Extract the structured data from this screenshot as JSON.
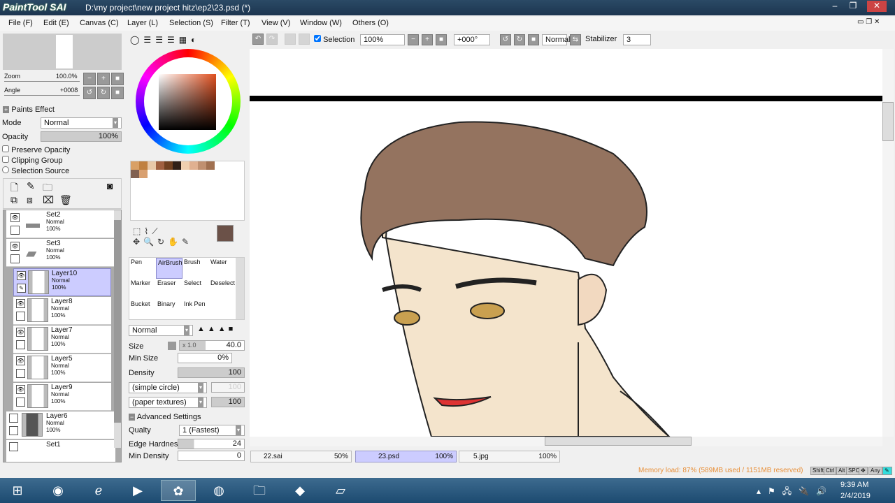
{
  "window": {
    "app_logo": "PaintTool SAI",
    "title": "D:\\my project\\new project hitz\\ep2\\23.psd (*)"
  },
  "menu": [
    "File (F)",
    "Edit (E)",
    "Canvas (C)",
    "Layer (L)",
    "Selection (S)",
    "Filter (T)",
    "View (V)",
    "Window (W)",
    "Others (O)"
  ],
  "toolbar": {
    "selection_label": "Selection",
    "selection_checked": true,
    "zoom": "100%",
    "angle": "+000°",
    "blend": "Normal",
    "stabilizer_label": "Stabilizer",
    "stabilizer": "3"
  },
  "navigator": {
    "zoom_label": "Zoom",
    "zoom_value": "100.0%",
    "angle_label": "Angle",
    "angle_value": "+0008"
  },
  "layer_props": {
    "paints_effect": "Paints Effect",
    "mode_label": "Mode",
    "mode": "Normal",
    "opacity_label": "Opacity",
    "opacity": "100%",
    "preserve_opacity": "Preserve Opacity",
    "clipping_group": "Clipping Group",
    "selection_source": "Selection Source"
  },
  "layers": [
    {
      "name": "Set2",
      "mode": "Normal",
      "opacity": "100%",
      "type": "folder",
      "visible": true
    },
    {
      "name": "Set3",
      "mode": "Normal",
      "opacity": "100%",
      "type": "folder-open",
      "visible": true
    },
    {
      "name": "Layer10",
      "mode": "Normal",
      "opacity": "100%",
      "type": "layer",
      "visible": true,
      "selected": true
    },
    {
      "name": "Layer8",
      "mode": "Normal",
      "opacity": "100%",
      "type": "layer",
      "visible": true
    },
    {
      "name": "Layer7",
      "mode": "Normal",
      "opacity": "100%",
      "type": "layer",
      "visible": true
    },
    {
      "name": "Layer5",
      "mode": "Normal",
      "opacity": "100%",
      "type": "layer",
      "visible": true
    },
    {
      "name": "Layer9",
      "mode": "Normal",
      "opacity": "100%",
      "type": "layer",
      "visible": true
    },
    {
      "name": "Layer6",
      "mode": "Normal",
      "opacity": "100%",
      "type": "layer",
      "visible": false
    },
    {
      "name": "Set1",
      "type": "folder",
      "visible": false
    }
  ],
  "tools": [
    "Pen",
    "AirBrush",
    "Brush",
    "Water",
    "Marker",
    "Eraser",
    "Select",
    "Deselect",
    "Bucket",
    "Binary",
    "Ink Pen"
  ],
  "brush": {
    "blend": "Normal",
    "size_label": "Size",
    "size_mult": "x 1.0",
    "size": "40.0",
    "min_size_label": "Min Size",
    "min_size": "0%",
    "density_label": "Density",
    "density": "100",
    "shape": "(simple circle)",
    "shape_value": "100",
    "texture": "(paper textures)",
    "texture_value": "100",
    "advanced": "Advanced Settings",
    "quality_label": "Qualty",
    "quality": "1 (Fastest)",
    "edge_label": "Edge Hardness",
    "edge": "24",
    "min_density_label": "Min Density",
    "min_density": "0"
  },
  "colors": {
    "primary": "#6b5148",
    "swatches": [
      "#d9a066",
      "#c08040",
      "#e8c8a8",
      "#a06040",
      "#704020",
      "#302018",
      "#f0d0b0",
      "#e0b090",
      "#c09070",
      "#a07050",
      "#806050",
      "#d8a070"
    ]
  },
  "doc_tabs": [
    {
      "name": "22.sai",
      "zoom": "50%"
    },
    {
      "name": "23.psd",
      "zoom": "100%",
      "active": true
    },
    {
      "name": "5.jpg",
      "zoom": "100%"
    }
  ],
  "status": {
    "memory": "Memory load: 87% (589MB used / 1151MB reserved)",
    "keys": [
      "Shift",
      "Ctrl",
      "Alt",
      "SPC",
      "✥",
      "Any"
    ]
  },
  "taskbar": {
    "time": "9:39 AM",
    "date": "2/4/2019"
  }
}
